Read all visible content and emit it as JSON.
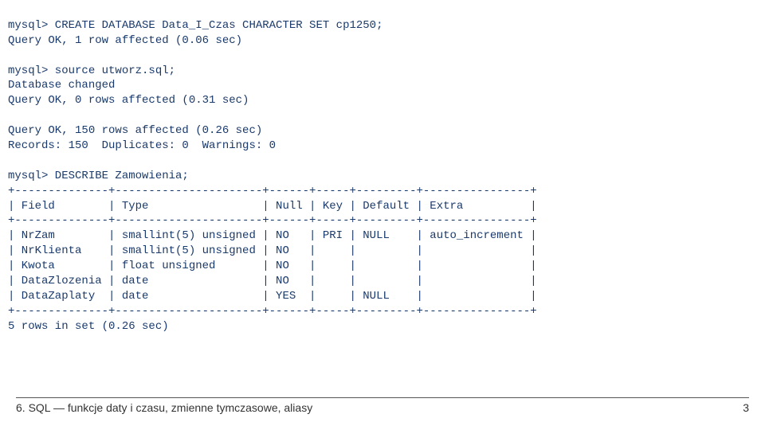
{
  "lines": {
    "l1": "mysql> CREATE DATABASE Data_I_Czas CHARACTER SET cp1250;",
    "l2": "Query OK, 1 row affected (0.06 sec)",
    "l3": "",
    "l4": "mysql> source utworz.sql;",
    "l5": "Database changed",
    "l6": "Query OK, 0 rows affected (0.31 sec)",
    "l7": "",
    "l8": "Query OK, 150 rows affected (0.26 sec)",
    "l9": "Records: 150  Duplicates: 0  Warnings: 0",
    "l10": "",
    "l11": "mysql> DESCRIBE Zamowienia;",
    "l12": "+--------------+----------------------+------+-----+---------+----------------+",
    "l13": "| Field        | Type                 | Null | Key | Default | Extra          |",
    "l14": "+--------------+----------------------+------+-----+---------+----------------+",
    "l15": "| NrZam        | smallint(5) unsigned | NO   | PRI | NULL    | auto_increment |",
    "l16": "| NrKlienta    | smallint(5) unsigned | NO   |     |         |                |",
    "l17": "| Kwota        | float unsigned       | NO   |     |         |                |",
    "l18": "| DataZlozenia | date                 | NO   |     |         |                |",
    "l19": "| DataZaplaty  | date                 | YES  |     | NULL    |                |",
    "l20": "+--------------+----------------------+------+-----+---------+----------------+",
    "l21": "5 rows in set (0.26 sec)"
  },
  "chart_data": {
    "type": "table",
    "title": "DESCRIBE Zamowienia",
    "columns": [
      "Field",
      "Type",
      "Null",
      "Key",
      "Default",
      "Extra"
    ],
    "rows": [
      [
        "NrZam",
        "smallint(5) unsigned",
        "NO",
        "PRI",
        "NULL",
        "auto_increment"
      ],
      [
        "NrKlienta",
        "smallint(5) unsigned",
        "NO",
        "",
        "",
        ""
      ],
      [
        "Kwota",
        "float unsigned",
        "NO",
        "",
        "",
        ""
      ],
      [
        "DataZlozenia",
        "date",
        "NO",
        "",
        "",
        ""
      ],
      [
        "DataZaplaty",
        "date",
        "YES",
        "",
        "NULL",
        ""
      ]
    ]
  },
  "footer": {
    "title": "6. SQL — funkcje daty i czasu, zmienne tymczasowe, aliasy",
    "page": "3"
  }
}
